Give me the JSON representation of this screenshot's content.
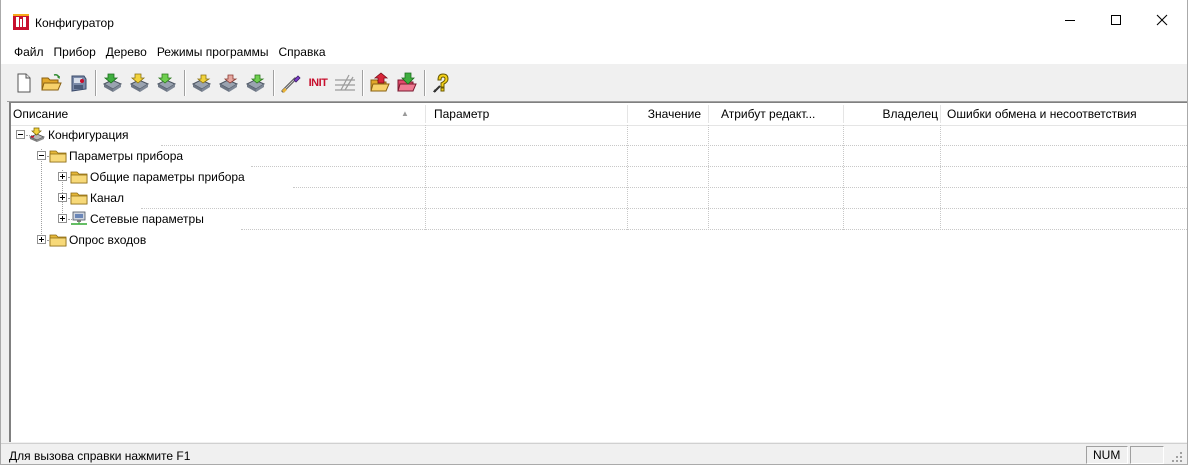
{
  "window": {
    "title": "Конфигуратор"
  },
  "menu": [
    "Файл",
    "Прибор",
    "Дерево",
    "Режимы программы",
    "Справка"
  ],
  "toolbar": {
    "buttons": [
      "new-file-icon",
      "open-folder-icon",
      "save-device-icon",
      "read-all-icon",
      "read-changed-icon",
      "read-selected-icon",
      "write-all-icon",
      "write-changed-icon",
      "write-selected-icon",
      "wand-icon",
      "init-icon",
      "settings-icon",
      "upload-icon",
      "download-icon",
      "help-icon"
    ],
    "init_label": "INIT"
  },
  "columns": [
    "Описание",
    "Параметр",
    "Значение",
    "Атрибут редакт...",
    "Владелец",
    "Ошибки обмена и несоответствия"
  ],
  "tree": [
    {
      "label": "Конфигурация",
      "level": 0,
      "expanded": true,
      "icon": "configuration-icon"
    },
    {
      "label": "Параметры прибора",
      "level": 1,
      "expanded": true,
      "icon": "folder-icon"
    },
    {
      "label": "Общие параметры прибора",
      "level": 2,
      "expanded": false,
      "icon": "folder-icon"
    },
    {
      "label": "Канал",
      "level": 2,
      "expanded": false,
      "icon": "folder-icon"
    },
    {
      "label": "Сетевые параметры",
      "level": 2,
      "expanded": false,
      "icon": "network-icon"
    },
    {
      "label": "Опрос входов",
      "level": 1,
      "expanded": false,
      "icon": "folder-icon"
    }
  ],
  "status": {
    "text": "Для вызова справки нажмите F1",
    "num": "NUM"
  },
  "colors": {
    "folder": "#f2c94c",
    "accent_green": "#3fae3f",
    "accent_red": "#d9263a"
  }
}
